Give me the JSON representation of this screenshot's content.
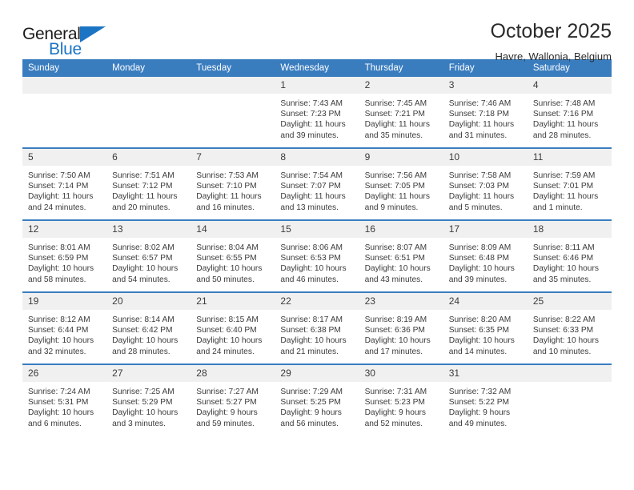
{
  "logo": {
    "word_one": "General",
    "word_two": "Blue",
    "triangle_icon": "triangle-icon",
    "accent_color": "#1c74c4"
  },
  "header": {
    "title": "October 2025",
    "subtitle": "Havre, Wallonia, Belgium"
  },
  "theme": {
    "header_blue": "#3a7dbf",
    "daynum_band": "#f0f0f0",
    "text": "#3b3b3b"
  },
  "calendar": {
    "weekday_headers": [
      "Sunday",
      "Monday",
      "Tuesday",
      "Wednesday",
      "Thursday",
      "Friday",
      "Saturday"
    ],
    "labels": {
      "sunrise": "Sunrise:",
      "sunset": "Sunset:",
      "daylight": "Daylight:"
    },
    "weeks": [
      [
        {
          "day": "",
          "sunrise": "",
          "sunset": "",
          "daylight_line1": "",
          "daylight_line2": "",
          "blank": true
        },
        {
          "day": "",
          "sunrise": "",
          "sunset": "",
          "daylight_line1": "",
          "daylight_line2": "",
          "blank": true
        },
        {
          "day": "",
          "sunrise": "",
          "sunset": "",
          "daylight_line1": "",
          "daylight_line2": "",
          "blank": true
        },
        {
          "day": "1",
          "sunrise": "Sunrise: 7:43 AM",
          "sunset": "Sunset: 7:23 PM",
          "daylight_line1": "Daylight: 11 hours",
          "daylight_line2": "and 39 minutes."
        },
        {
          "day": "2",
          "sunrise": "Sunrise: 7:45 AM",
          "sunset": "Sunset: 7:21 PM",
          "daylight_line1": "Daylight: 11 hours",
          "daylight_line2": "and 35 minutes."
        },
        {
          "day": "3",
          "sunrise": "Sunrise: 7:46 AM",
          "sunset": "Sunset: 7:18 PM",
          "daylight_line1": "Daylight: 11 hours",
          "daylight_line2": "and 31 minutes."
        },
        {
          "day": "4",
          "sunrise": "Sunrise: 7:48 AM",
          "sunset": "Sunset: 7:16 PM",
          "daylight_line1": "Daylight: 11 hours",
          "daylight_line2": "and 28 minutes."
        }
      ],
      [
        {
          "day": "5",
          "sunrise": "Sunrise: 7:50 AM",
          "sunset": "Sunset: 7:14 PM",
          "daylight_line1": "Daylight: 11 hours",
          "daylight_line2": "and 24 minutes."
        },
        {
          "day": "6",
          "sunrise": "Sunrise: 7:51 AM",
          "sunset": "Sunset: 7:12 PM",
          "daylight_line1": "Daylight: 11 hours",
          "daylight_line2": "and 20 minutes."
        },
        {
          "day": "7",
          "sunrise": "Sunrise: 7:53 AM",
          "sunset": "Sunset: 7:10 PM",
          "daylight_line1": "Daylight: 11 hours",
          "daylight_line2": "and 16 minutes."
        },
        {
          "day": "8",
          "sunrise": "Sunrise: 7:54 AM",
          "sunset": "Sunset: 7:07 PM",
          "daylight_line1": "Daylight: 11 hours",
          "daylight_line2": "and 13 minutes."
        },
        {
          "day": "9",
          "sunrise": "Sunrise: 7:56 AM",
          "sunset": "Sunset: 7:05 PM",
          "daylight_line1": "Daylight: 11 hours",
          "daylight_line2": "and 9 minutes."
        },
        {
          "day": "10",
          "sunrise": "Sunrise: 7:58 AM",
          "sunset": "Sunset: 7:03 PM",
          "daylight_line1": "Daylight: 11 hours",
          "daylight_line2": "and 5 minutes."
        },
        {
          "day": "11",
          "sunrise": "Sunrise: 7:59 AM",
          "sunset": "Sunset: 7:01 PM",
          "daylight_line1": "Daylight: 11 hours",
          "daylight_line2": "and 1 minute."
        }
      ],
      [
        {
          "day": "12",
          "sunrise": "Sunrise: 8:01 AM",
          "sunset": "Sunset: 6:59 PM",
          "daylight_line1": "Daylight: 10 hours",
          "daylight_line2": "and 58 minutes."
        },
        {
          "day": "13",
          "sunrise": "Sunrise: 8:02 AM",
          "sunset": "Sunset: 6:57 PM",
          "daylight_line1": "Daylight: 10 hours",
          "daylight_line2": "and 54 minutes."
        },
        {
          "day": "14",
          "sunrise": "Sunrise: 8:04 AM",
          "sunset": "Sunset: 6:55 PM",
          "daylight_line1": "Daylight: 10 hours",
          "daylight_line2": "and 50 minutes."
        },
        {
          "day": "15",
          "sunrise": "Sunrise: 8:06 AM",
          "sunset": "Sunset: 6:53 PM",
          "daylight_line1": "Daylight: 10 hours",
          "daylight_line2": "and 46 minutes."
        },
        {
          "day": "16",
          "sunrise": "Sunrise: 8:07 AM",
          "sunset": "Sunset: 6:51 PM",
          "daylight_line1": "Daylight: 10 hours",
          "daylight_line2": "and 43 minutes."
        },
        {
          "day": "17",
          "sunrise": "Sunrise: 8:09 AM",
          "sunset": "Sunset: 6:48 PM",
          "daylight_line1": "Daylight: 10 hours",
          "daylight_line2": "and 39 minutes."
        },
        {
          "day": "18",
          "sunrise": "Sunrise: 8:11 AM",
          "sunset": "Sunset: 6:46 PM",
          "daylight_line1": "Daylight: 10 hours",
          "daylight_line2": "and 35 minutes."
        }
      ],
      [
        {
          "day": "19",
          "sunrise": "Sunrise: 8:12 AM",
          "sunset": "Sunset: 6:44 PM",
          "daylight_line1": "Daylight: 10 hours",
          "daylight_line2": "and 32 minutes."
        },
        {
          "day": "20",
          "sunrise": "Sunrise: 8:14 AM",
          "sunset": "Sunset: 6:42 PM",
          "daylight_line1": "Daylight: 10 hours",
          "daylight_line2": "and 28 minutes."
        },
        {
          "day": "21",
          "sunrise": "Sunrise: 8:15 AM",
          "sunset": "Sunset: 6:40 PM",
          "daylight_line1": "Daylight: 10 hours",
          "daylight_line2": "and 24 minutes."
        },
        {
          "day": "22",
          "sunrise": "Sunrise: 8:17 AM",
          "sunset": "Sunset: 6:38 PM",
          "daylight_line1": "Daylight: 10 hours",
          "daylight_line2": "and 21 minutes."
        },
        {
          "day": "23",
          "sunrise": "Sunrise: 8:19 AM",
          "sunset": "Sunset: 6:36 PM",
          "daylight_line1": "Daylight: 10 hours",
          "daylight_line2": "and 17 minutes."
        },
        {
          "day": "24",
          "sunrise": "Sunrise: 8:20 AM",
          "sunset": "Sunset: 6:35 PM",
          "daylight_line1": "Daylight: 10 hours",
          "daylight_line2": "and 14 minutes."
        },
        {
          "day": "25",
          "sunrise": "Sunrise: 8:22 AM",
          "sunset": "Sunset: 6:33 PM",
          "daylight_line1": "Daylight: 10 hours",
          "daylight_line2": "and 10 minutes."
        }
      ],
      [
        {
          "day": "26",
          "sunrise": "Sunrise: 7:24 AM",
          "sunset": "Sunset: 5:31 PM",
          "daylight_line1": "Daylight: 10 hours",
          "daylight_line2": "and 6 minutes."
        },
        {
          "day": "27",
          "sunrise": "Sunrise: 7:25 AM",
          "sunset": "Sunset: 5:29 PM",
          "daylight_line1": "Daylight: 10 hours",
          "daylight_line2": "and 3 minutes."
        },
        {
          "day": "28",
          "sunrise": "Sunrise: 7:27 AM",
          "sunset": "Sunset: 5:27 PM",
          "daylight_line1": "Daylight: 9 hours",
          "daylight_line2": "and 59 minutes."
        },
        {
          "day": "29",
          "sunrise": "Sunrise: 7:29 AM",
          "sunset": "Sunset: 5:25 PM",
          "daylight_line1": "Daylight: 9 hours",
          "daylight_line2": "and 56 minutes."
        },
        {
          "day": "30",
          "sunrise": "Sunrise: 7:31 AM",
          "sunset": "Sunset: 5:23 PM",
          "daylight_line1": "Daylight: 9 hours",
          "daylight_line2": "and 52 minutes."
        },
        {
          "day": "31",
          "sunrise": "Sunrise: 7:32 AM",
          "sunset": "Sunset: 5:22 PM",
          "daylight_line1": "Daylight: 9 hours",
          "daylight_line2": "and 49 minutes."
        },
        {
          "day": "",
          "sunrise": "",
          "sunset": "",
          "daylight_line1": "",
          "daylight_line2": "",
          "blank": true
        }
      ]
    ]
  }
}
